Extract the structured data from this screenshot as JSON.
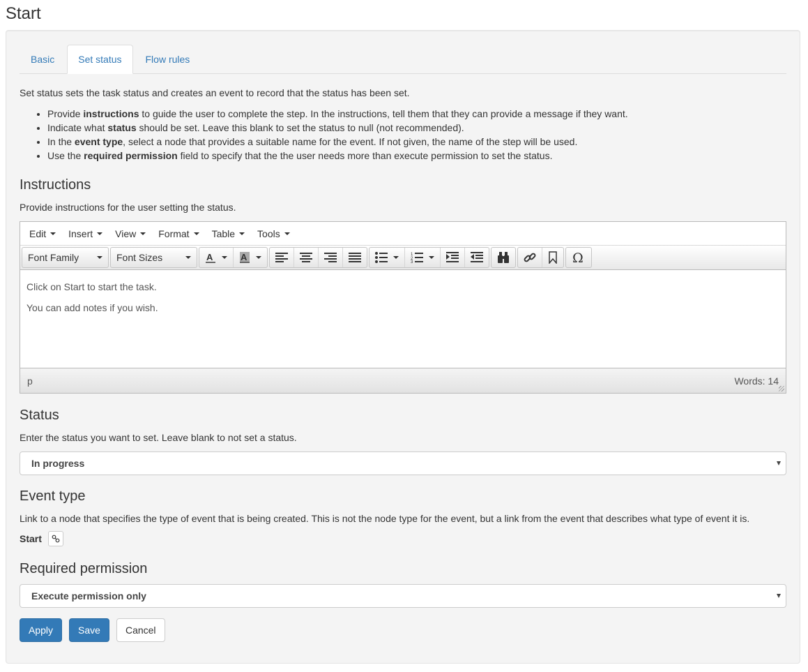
{
  "page_title": "Start",
  "tabs": [
    {
      "label": "Basic",
      "active": false
    },
    {
      "label": "Set status",
      "active": true
    },
    {
      "label": "Flow rules",
      "active": false
    }
  ],
  "intro": "Set status sets the task status and creates an event to record that the status has been set.",
  "help_items": [
    {
      "pre": "Provide ",
      "bold": "instructions",
      "post": " to guide the user to complete the step. In the instructions, tell them that they can provide a message if they want."
    },
    {
      "pre": "Indicate what ",
      "bold": "status",
      "post": " should be set. Leave this blank to set the status to null (not recommended)."
    },
    {
      "pre": "In the ",
      "bold": "event type",
      "post": ", select a node that provides a suitable name for the event. If not given, the name of the step will be used."
    },
    {
      "pre": "Use the ",
      "bold": "required permission",
      "post": " field to specify that the the user needs more than execute permission to set the status."
    }
  ],
  "instructions": {
    "heading": "Instructions",
    "description": "Provide instructions for the user setting the status.",
    "editor": {
      "menus": [
        "Edit",
        "Insert",
        "View",
        "Format",
        "Table",
        "Tools"
      ],
      "font_family_label": "Font Family",
      "font_sizes_label": "Font Sizes",
      "content": [
        "Click on Start to start the task.",
        "You can add notes if you wish."
      ],
      "path": "p",
      "word_count": "Words: 14"
    }
  },
  "status": {
    "heading": "Status",
    "description": "Enter the status you want to set. Leave blank to not set a status.",
    "selected": "In progress"
  },
  "event_type": {
    "heading": "Event type",
    "description": "Link to a node that specifies the type of event that is being created. This is not the node type for the event, but a link from the event that describes what type of event it is.",
    "value": "Start"
  },
  "required_permission": {
    "heading": "Required permission",
    "selected": "Execute permission only"
  },
  "buttons": {
    "apply": "Apply",
    "save": "Save",
    "cancel": "Cancel"
  },
  "colors": {
    "primary": "#337ab7",
    "link": "#337ab7",
    "panel_bg": "#f4f4f4"
  }
}
